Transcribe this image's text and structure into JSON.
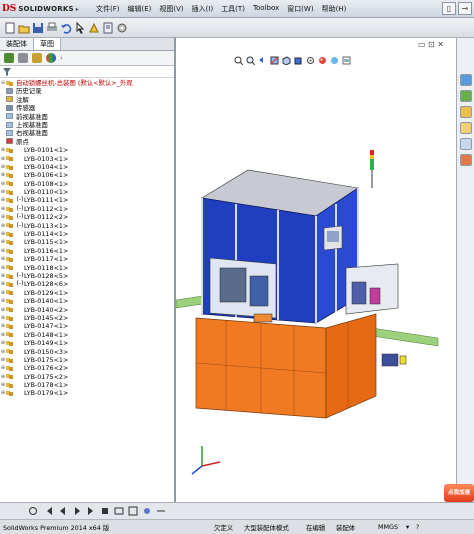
{
  "app": {
    "brand_prefix": "DS",
    "brand": "SOLIDWORKS"
  },
  "menu": [
    "文件(F)",
    "编辑(E)",
    "视图(V)",
    "插入(I)",
    "工具(T)",
    "Toolbox",
    "窗口(W)",
    "帮助(H)"
  ],
  "panel": {
    "tabs": [
      "装配体",
      "草图"
    ]
  },
  "tree": {
    "root": "自动锁螺丝机-总装图 (默认<默认>_外观",
    "features": [
      "历史记录",
      "注解",
      "传感器",
      "前视基准面",
      "上视基准面",
      "右视基准面",
      "原点"
    ],
    "parts": [
      {
        "prefix": "",
        "label": "LYB-0101<1>"
      },
      {
        "prefix": "",
        "label": "LYB-0103<1>"
      },
      {
        "prefix": "",
        "label": "LYB-0104<1>"
      },
      {
        "prefix": "",
        "label": "LYB-0106<1>"
      },
      {
        "prefix": "",
        "label": "LYB-0108<1>"
      },
      {
        "prefix": "",
        "label": "LYB-0110<1>"
      },
      {
        "prefix": "(-)",
        "label": "LYB-0111<1>"
      },
      {
        "prefix": "(-)",
        "label": "LYB-0112<1>"
      },
      {
        "prefix": "(-)",
        "label": "LYB-0112<2>"
      },
      {
        "prefix": "(-)",
        "label": "LYB-0113<1>"
      },
      {
        "prefix": "",
        "label": "LYB-0114<1>"
      },
      {
        "prefix": "",
        "label": "LYB-0115<1>"
      },
      {
        "prefix": "",
        "label": "LYB-0116<1>"
      },
      {
        "prefix": "",
        "label": "LYB-0117<1>"
      },
      {
        "prefix": "",
        "label": "LYB-0118<1>"
      },
      {
        "prefix": "(-)",
        "label": "LYB-0128<5>"
      },
      {
        "prefix": "(-)",
        "label": "LYB-0128<6>"
      },
      {
        "prefix": "",
        "label": "LYB-0129<1>"
      },
      {
        "prefix": "",
        "label": "LYB-0140<1>"
      },
      {
        "prefix": "",
        "label": "LYB-0140<2>"
      },
      {
        "prefix": "",
        "label": "LYB-0145<2>"
      },
      {
        "prefix": "",
        "label": "LYB-0147<1>"
      },
      {
        "prefix": "",
        "label": "LYB-0148<1>"
      },
      {
        "prefix": "",
        "label": "LYB-0149<1>"
      },
      {
        "prefix": "",
        "label": "LYB-0150<3>"
      },
      {
        "prefix": "",
        "label": "LYB-0175<1>"
      },
      {
        "prefix": "",
        "label": "LYB-0176<2>"
      },
      {
        "prefix": "",
        "label": "LYB-0175<2>"
      },
      {
        "prefix": "",
        "label": "LYB-0178<1>"
      },
      {
        "prefix": "",
        "label": "LYB-0179<1>"
      }
    ]
  },
  "status": {
    "product": "SolidWorks Premium 2014 x64 版",
    "underdefined": "欠定义",
    "mode": "大型装配体模式",
    "editing": "在编辑",
    "doc": "装配体",
    "units": "MMGS"
  },
  "watermark": "点我加速",
  "colors": {
    "frame_blue": "#1f3fc0",
    "base_orange": "#f07a22",
    "tree_root_red": "#c00000"
  }
}
